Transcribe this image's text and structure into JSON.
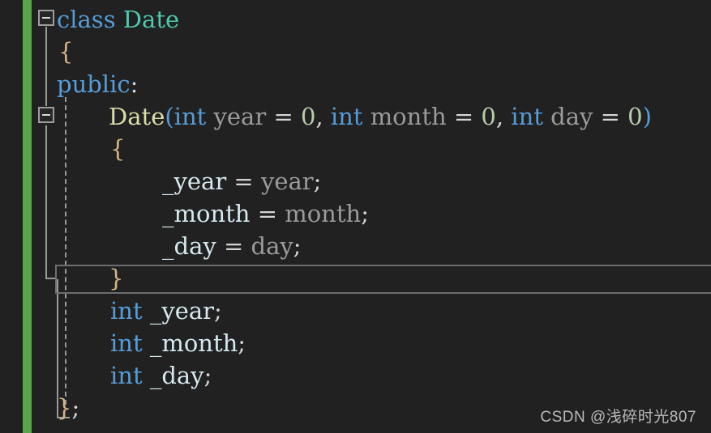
{
  "editor": {
    "background_color": "#212121",
    "change_bar_color": "#57a64a",
    "highlight_border_color": "#6e6e6e",
    "guide_color": "#9a9a9a"
  },
  "code": {
    "language": "C++",
    "lines": [
      {
        "index": 0,
        "text": "class Date",
        "tokens": [
          {
            "t": "class",
            "c": "kw"
          },
          {
            "t": " ",
            "c": "punc"
          },
          {
            "t": "Date",
            "c": "type"
          }
        ]
      },
      {
        "index": 1,
        "text": "{",
        "tokens": [
          {
            "t": "{",
            "c": "brace"
          }
        ]
      },
      {
        "index": 2,
        "text": "public:",
        "tokens": [
          {
            "t": "public",
            "c": "kw"
          },
          {
            "t": ":",
            "c": "punc"
          }
        ]
      },
      {
        "index": 3,
        "text": "Date(int year = 0, int month = 0, int day = 0)",
        "tokens": [
          {
            "t": "Date",
            "c": "fn"
          },
          {
            "t": "(",
            "c": "paren"
          },
          {
            "t": "int",
            "c": "kw"
          },
          {
            "t": " ",
            "c": "punc"
          },
          {
            "t": "year",
            "c": "param"
          },
          {
            "t": " ",
            "c": "punc"
          },
          {
            "t": "=",
            "c": "punc"
          },
          {
            "t": " ",
            "c": "punc"
          },
          {
            "t": "0",
            "c": "num"
          },
          {
            "t": ",",
            "c": "punc"
          },
          {
            "t": " ",
            "c": "punc"
          },
          {
            "t": "int",
            "c": "kw"
          },
          {
            "t": " ",
            "c": "punc"
          },
          {
            "t": "month",
            "c": "param"
          },
          {
            "t": " ",
            "c": "punc"
          },
          {
            "t": "=",
            "c": "punc"
          },
          {
            "t": " ",
            "c": "punc"
          },
          {
            "t": "0",
            "c": "num"
          },
          {
            "t": ",",
            "c": "punc"
          },
          {
            "t": " ",
            "c": "punc"
          },
          {
            "t": "int",
            "c": "kw"
          },
          {
            "t": " ",
            "c": "punc"
          },
          {
            "t": "day",
            "c": "param"
          },
          {
            "t": " ",
            "c": "punc"
          },
          {
            "t": "=",
            "c": "punc"
          },
          {
            "t": " ",
            "c": "punc"
          },
          {
            "t": "0",
            "c": "num"
          },
          {
            "t": ")",
            "c": "paren"
          }
        ]
      },
      {
        "index": 4,
        "text": "{",
        "tokens": [
          {
            "t": "{",
            "c": "brace"
          }
        ]
      },
      {
        "index": 5,
        "text": "_year = year;",
        "tokens": [
          {
            "t": "_year",
            "c": "member"
          },
          {
            "t": " ",
            "c": "punc"
          },
          {
            "t": "=",
            "c": "punc"
          },
          {
            "t": " ",
            "c": "punc"
          },
          {
            "t": "year",
            "c": "param"
          },
          {
            "t": ";",
            "c": "punc"
          }
        ]
      },
      {
        "index": 6,
        "text": "_month = month;",
        "tokens": [
          {
            "t": "_month",
            "c": "member"
          },
          {
            "t": " ",
            "c": "punc"
          },
          {
            "t": "=",
            "c": "punc"
          },
          {
            "t": " ",
            "c": "punc"
          },
          {
            "t": "month",
            "c": "param"
          },
          {
            "t": ";",
            "c": "punc"
          }
        ]
      },
      {
        "index": 7,
        "text": "_day = day;",
        "tokens": [
          {
            "t": "_day",
            "c": "member"
          },
          {
            "t": " ",
            "c": "punc"
          },
          {
            "t": "=",
            "c": "punc"
          },
          {
            "t": " ",
            "c": "punc"
          },
          {
            "t": "day",
            "c": "param"
          },
          {
            "t": ";",
            "c": "punc"
          }
        ]
      },
      {
        "index": 8,
        "text": "}",
        "tokens": [
          {
            "t": "}",
            "c": "brace"
          }
        ]
      },
      {
        "index": 9,
        "text": "int _year;",
        "tokens": [
          {
            "t": "int",
            "c": "kw"
          },
          {
            "t": " ",
            "c": "punc"
          },
          {
            "t": "_year",
            "c": "member"
          },
          {
            "t": ";",
            "c": "punc"
          }
        ]
      },
      {
        "index": 10,
        "text": "int _month;",
        "tokens": [
          {
            "t": "int",
            "c": "kw"
          },
          {
            "t": " ",
            "c": "punc"
          },
          {
            "t": "_month",
            "c": "member"
          },
          {
            "t": ";",
            "c": "punc"
          }
        ]
      },
      {
        "index": 11,
        "text": "int _day;",
        "tokens": [
          {
            "t": "int",
            "c": "kw"
          },
          {
            "t": " ",
            "c": "punc"
          },
          {
            "t": "_day",
            "c": "member"
          },
          {
            "t": ";",
            "c": "punc"
          }
        ]
      },
      {
        "index": 12,
        "text": "};",
        "tokens": [
          {
            "t": "}",
            "c": "brace"
          },
          {
            "t": ";",
            "c": "punc"
          }
        ]
      }
    ]
  },
  "fold_markers": [
    {
      "name": "fold-toggle-class",
      "line": 0,
      "state": "expanded",
      "glyph": "minus"
    },
    {
      "name": "fold-toggle-constructor",
      "line": 3,
      "state": "expanded",
      "glyph": "minus"
    }
  ],
  "watermark": {
    "text": "CSDN @浅碎时光807"
  }
}
